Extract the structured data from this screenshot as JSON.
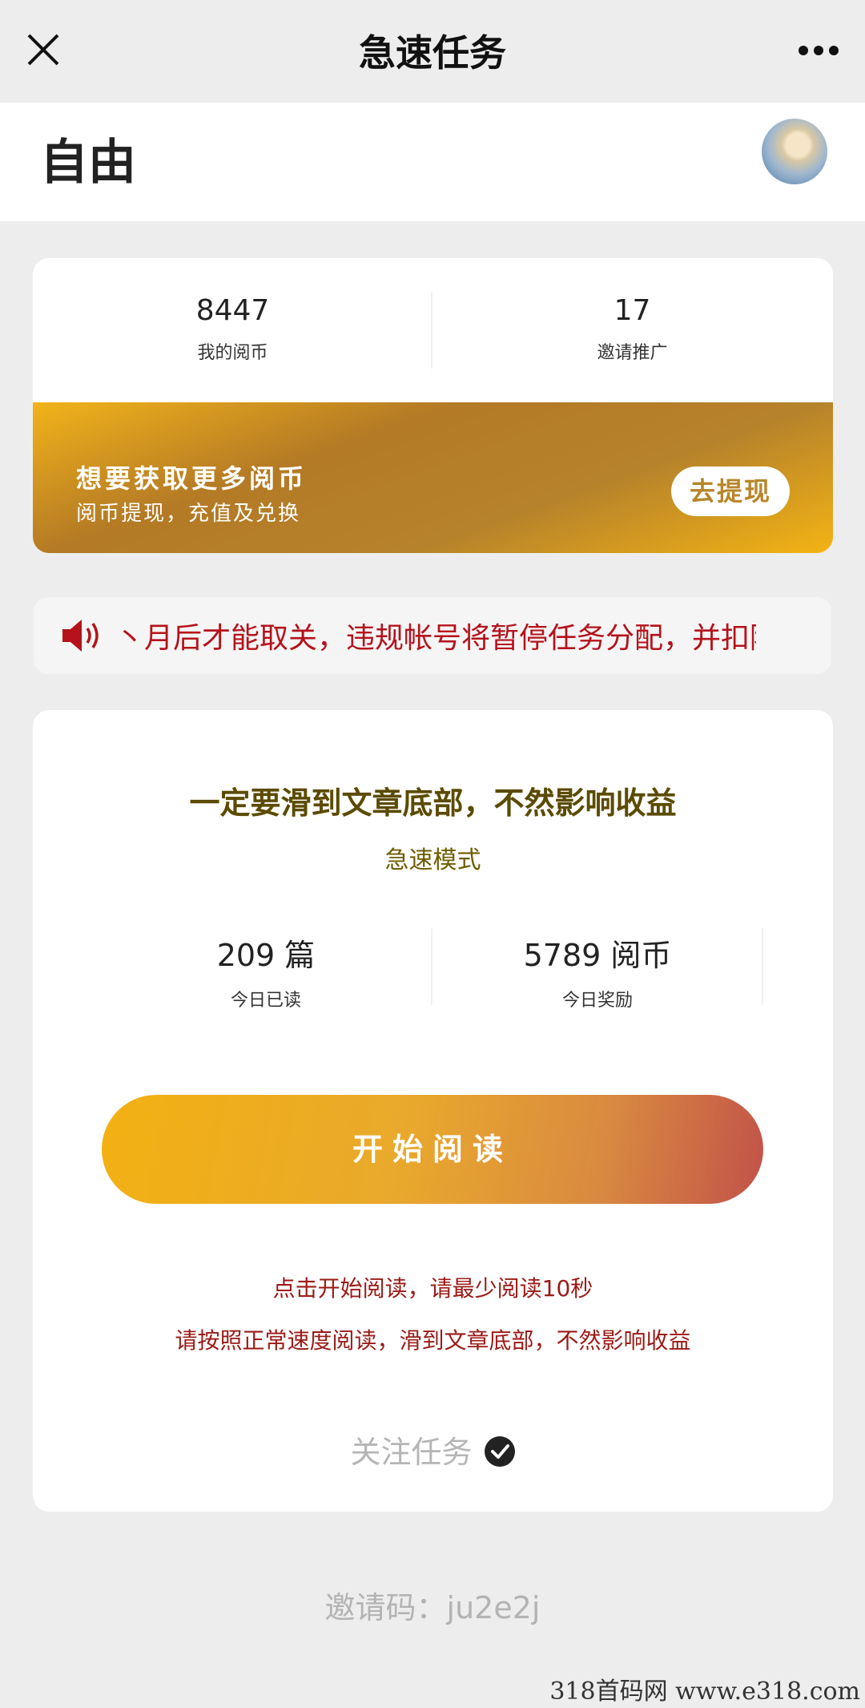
{
  "topbar": {
    "title": "急速任务"
  },
  "user": {
    "name": "自由"
  },
  "stats": [
    {
      "value": "8447",
      "label": "我的阅币"
    },
    {
      "value": "17",
      "label": "邀请推广"
    }
  ],
  "promo": {
    "title": "想要获取更多阅币",
    "subtitle": "阅币提现，充值及兑换",
    "button": "去提现"
  },
  "notice": {
    "text": "丶月后才能取关，违规帐号将暂停任务分配，并扣除该"
  },
  "main": {
    "headline": "一定要滑到文章底部，不然影响收益",
    "mode": "急速模式",
    "today_stats": [
      {
        "value": "209 篇",
        "label": "今日已读"
      },
      {
        "value": "5789 阅币",
        "label": "今日奖励"
      }
    ],
    "start_button": "开始阅读",
    "tip1": "点击开始阅读，请最少阅读10秒",
    "tip2": "请按照正常速度阅读，滑到文章底部，不然影响收益",
    "follow_label": "关注任务"
  },
  "invite": {
    "text": "邀请码：ju2e2j"
  },
  "watermark": "318首码网 www.e318.com",
  "colors": {
    "accent": "#f2b112",
    "warning": "#b5121b",
    "promo_dark": "#b47a25"
  },
  "icons": [
    "close-icon",
    "more-icon",
    "speaker-icon",
    "check-icon"
  ]
}
